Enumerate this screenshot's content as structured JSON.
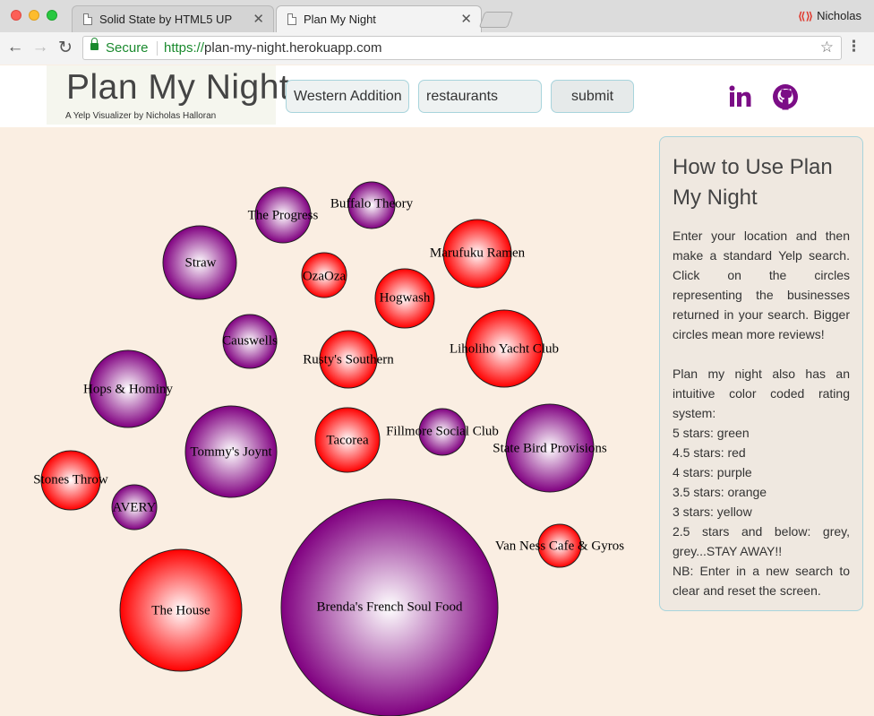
{
  "browser": {
    "tabs": [
      {
        "title": "Solid State by HTML5 UP",
        "active": false
      },
      {
        "title": "Plan My Night",
        "active": true
      }
    ],
    "profile_name": "Nicholas",
    "secure_label": "Secure",
    "url_scheme": "https://",
    "url_rest": "plan-my-night.herokuapp.com"
  },
  "header": {
    "logo_title": "Plan My Night",
    "logo_subtitle": "A Yelp Visualizer by Nicholas Halloran",
    "location_value": "Western Addition",
    "search_value": "restaurants",
    "submit_label": "submit",
    "social_icons": [
      "linkedin-icon",
      "github-icon"
    ]
  },
  "colors": {
    "page_background": "#faeee2",
    "accent_purple": "#7b0d86",
    "panel_border": "#a8d4dc",
    "rating_red": "#ff0000",
    "rating_purple": "#800080"
  },
  "businesses": [
    {
      "name": "Buffalo Theory",
      "rating_color": "purple"
    },
    {
      "name": "The Progress",
      "rating_color": "purple"
    },
    {
      "name": "Marufuku Ramen",
      "rating_color": "red"
    },
    {
      "name": "Straw",
      "rating_color": "purple"
    },
    {
      "name": "OzaOza",
      "rating_color": "red"
    },
    {
      "name": "Hogwash",
      "rating_color": "red"
    },
    {
      "name": "Causwells",
      "rating_color": "purple"
    },
    {
      "name": "Rusty's Southern",
      "rating_color": "red"
    },
    {
      "name": "Liholiho Yacht Club",
      "rating_color": "red"
    },
    {
      "name": "Hops & Hominy",
      "rating_color": "purple"
    },
    {
      "name": "Tommy's Joynt",
      "rating_color": "purple"
    },
    {
      "name": "Tacorea",
      "rating_color": "red"
    },
    {
      "name": "Fillmore Social Club",
      "rating_color": "purple"
    },
    {
      "name": "State Bird Provisions",
      "rating_color": "purple"
    },
    {
      "name": "Stones Throw",
      "rating_color": "red"
    },
    {
      "name": "AVERY",
      "rating_color": "purple"
    },
    {
      "name": "Van Ness Cafe & Gyros",
      "rating_color": "red"
    },
    {
      "name": "The House",
      "rating_color": "red"
    },
    {
      "name": "Brenda's French Soul Food",
      "rating_color": "purple"
    }
  ],
  "info": {
    "title": "How to Use Plan My Night",
    "intro": "Enter your location and then make a standard Yelp search. Click on the circles representing the businesses returned in your search. Bigger circles mean more reviews!",
    "rating_intro": "Plan my night also has an intuitive color coded rating system:",
    "ratings": [
      "5 stars: green",
      "4.5 stars: red",
      "4 stars: purple",
      "3.5 stars: orange",
      "3 stars: yellow",
      "2.5 stars and below: grey, grey...STAY AWAY!!"
    ],
    "note": "NB: Enter in a new search to clear and reset the screen."
  }
}
